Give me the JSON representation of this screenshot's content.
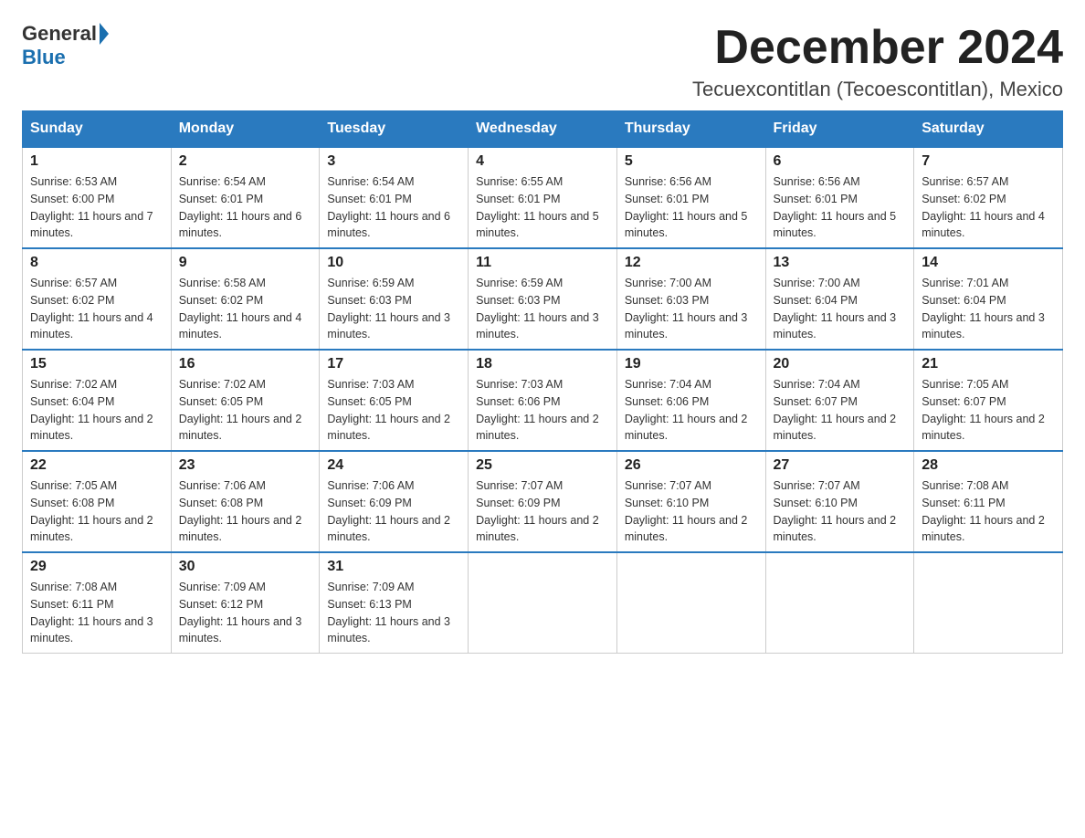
{
  "header": {
    "logo_general": "General",
    "logo_blue": "Blue",
    "month_title": "December 2024",
    "location": "Tecuexcontitlan (Tecoescontitlan), Mexico"
  },
  "weekdays": [
    "Sunday",
    "Monday",
    "Tuesday",
    "Wednesday",
    "Thursday",
    "Friday",
    "Saturday"
  ],
  "weeks": [
    [
      {
        "day": "1",
        "sunrise": "6:53 AM",
        "sunset": "6:00 PM",
        "daylight": "11 hours and 7 minutes."
      },
      {
        "day": "2",
        "sunrise": "6:54 AM",
        "sunset": "6:01 PM",
        "daylight": "11 hours and 6 minutes."
      },
      {
        "day": "3",
        "sunrise": "6:54 AM",
        "sunset": "6:01 PM",
        "daylight": "11 hours and 6 minutes."
      },
      {
        "day": "4",
        "sunrise": "6:55 AM",
        "sunset": "6:01 PM",
        "daylight": "11 hours and 5 minutes."
      },
      {
        "day": "5",
        "sunrise": "6:56 AM",
        "sunset": "6:01 PM",
        "daylight": "11 hours and 5 minutes."
      },
      {
        "day": "6",
        "sunrise": "6:56 AM",
        "sunset": "6:01 PM",
        "daylight": "11 hours and 5 minutes."
      },
      {
        "day": "7",
        "sunrise": "6:57 AM",
        "sunset": "6:02 PM",
        "daylight": "11 hours and 4 minutes."
      }
    ],
    [
      {
        "day": "8",
        "sunrise": "6:57 AM",
        "sunset": "6:02 PM",
        "daylight": "11 hours and 4 minutes."
      },
      {
        "day": "9",
        "sunrise": "6:58 AM",
        "sunset": "6:02 PM",
        "daylight": "11 hours and 4 minutes."
      },
      {
        "day": "10",
        "sunrise": "6:59 AM",
        "sunset": "6:03 PM",
        "daylight": "11 hours and 3 minutes."
      },
      {
        "day": "11",
        "sunrise": "6:59 AM",
        "sunset": "6:03 PM",
        "daylight": "11 hours and 3 minutes."
      },
      {
        "day": "12",
        "sunrise": "7:00 AM",
        "sunset": "6:03 PM",
        "daylight": "11 hours and 3 minutes."
      },
      {
        "day": "13",
        "sunrise": "7:00 AM",
        "sunset": "6:04 PM",
        "daylight": "11 hours and 3 minutes."
      },
      {
        "day": "14",
        "sunrise": "7:01 AM",
        "sunset": "6:04 PM",
        "daylight": "11 hours and 3 minutes."
      }
    ],
    [
      {
        "day": "15",
        "sunrise": "7:02 AM",
        "sunset": "6:04 PM",
        "daylight": "11 hours and 2 minutes."
      },
      {
        "day": "16",
        "sunrise": "7:02 AM",
        "sunset": "6:05 PM",
        "daylight": "11 hours and 2 minutes."
      },
      {
        "day": "17",
        "sunrise": "7:03 AM",
        "sunset": "6:05 PM",
        "daylight": "11 hours and 2 minutes."
      },
      {
        "day": "18",
        "sunrise": "7:03 AM",
        "sunset": "6:06 PM",
        "daylight": "11 hours and 2 minutes."
      },
      {
        "day": "19",
        "sunrise": "7:04 AM",
        "sunset": "6:06 PM",
        "daylight": "11 hours and 2 minutes."
      },
      {
        "day": "20",
        "sunrise": "7:04 AM",
        "sunset": "6:07 PM",
        "daylight": "11 hours and 2 minutes."
      },
      {
        "day": "21",
        "sunrise": "7:05 AM",
        "sunset": "6:07 PM",
        "daylight": "11 hours and 2 minutes."
      }
    ],
    [
      {
        "day": "22",
        "sunrise": "7:05 AM",
        "sunset": "6:08 PM",
        "daylight": "11 hours and 2 minutes."
      },
      {
        "day": "23",
        "sunrise": "7:06 AM",
        "sunset": "6:08 PM",
        "daylight": "11 hours and 2 minutes."
      },
      {
        "day": "24",
        "sunrise": "7:06 AM",
        "sunset": "6:09 PM",
        "daylight": "11 hours and 2 minutes."
      },
      {
        "day": "25",
        "sunrise": "7:07 AM",
        "sunset": "6:09 PM",
        "daylight": "11 hours and 2 minutes."
      },
      {
        "day": "26",
        "sunrise": "7:07 AM",
        "sunset": "6:10 PM",
        "daylight": "11 hours and 2 minutes."
      },
      {
        "day": "27",
        "sunrise": "7:07 AM",
        "sunset": "6:10 PM",
        "daylight": "11 hours and 2 minutes."
      },
      {
        "day": "28",
        "sunrise": "7:08 AM",
        "sunset": "6:11 PM",
        "daylight": "11 hours and 2 minutes."
      }
    ],
    [
      {
        "day": "29",
        "sunrise": "7:08 AM",
        "sunset": "6:11 PM",
        "daylight": "11 hours and 3 minutes."
      },
      {
        "day": "30",
        "sunrise": "7:09 AM",
        "sunset": "6:12 PM",
        "daylight": "11 hours and 3 minutes."
      },
      {
        "day": "31",
        "sunrise": "7:09 AM",
        "sunset": "6:13 PM",
        "daylight": "11 hours and 3 minutes."
      },
      null,
      null,
      null,
      null
    ]
  ]
}
